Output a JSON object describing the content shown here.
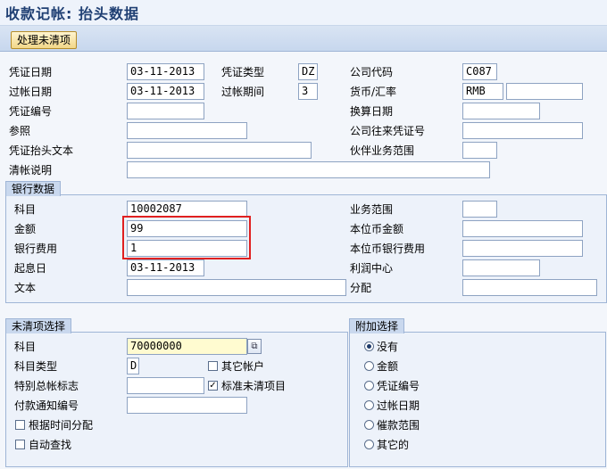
{
  "title": "收款记帐: 抬头数据",
  "toolbar": {
    "process_open_items": "处理未清项"
  },
  "header": {
    "doc_date_label": "凭证日期",
    "doc_date": "03-11-2013",
    "doc_type_label": "凭证类型",
    "doc_type": "DZ",
    "company_code_label": "公司代码",
    "company_code": "C087",
    "posting_date_label": "过帐日期",
    "posting_date": "03-11-2013",
    "period_label": "过帐期间",
    "period": "3",
    "currency_label": "货币/汇率",
    "currency": "RMB",
    "exchange_rate": "",
    "doc_number_label": "凭证编号",
    "doc_number": "",
    "translation_date_label": "换算日期",
    "translation_date": "",
    "reference_label": "参照",
    "reference": "",
    "intercompany_label": "公司往来凭证号",
    "intercompany": "",
    "header_text_label": "凭证抬头文本",
    "header_text": "",
    "partner_area_label": "伙伴业务范围",
    "partner_area": "",
    "clearing_text_label": "清帐说明",
    "clearing_text": ""
  },
  "bank": {
    "group_title": "银行数据",
    "account_label": "科目",
    "account": "10002087",
    "amount_label": "金额",
    "amount": "99",
    "bank_charges_label": "银行费用",
    "bank_charges": "1",
    "value_date_label": "起息日",
    "value_date": "03-11-2013",
    "text_label": "文本",
    "text": "",
    "business_area_label": "业务范围",
    "business_area": "",
    "lc_amount_label": "本位币金额",
    "lc_amount": "",
    "lc_bank_charges_label": "本位币银行费用",
    "lc_bank_charges": "",
    "profit_center_label": "利润中心",
    "profit_center": "",
    "assignment_label": "分配",
    "assignment": ""
  },
  "open_items": {
    "group_title": "未清项选择",
    "account_label": "科目",
    "account": "70000000",
    "account_type_label": "科目类型",
    "account_type": "D",
    "other_accounts_label": "其它帐户",
    "other_accounts_checked": false,
    "special_gl_label": "特别总帐标志",
    "special_gl": "",
    "standard_oi_label": "标准未清项目",
    "standard_oi_checked": true,
    "payment_advice_label": "付款通知编号",
    "payment_advice": "",
    "distribute_by_age_label": "根据时间分配",
    "distribute_by_age_checked": false,
    "auto_search_label": "自动查找",
    "auto_search_checked": false
  },
  "additional": {
    "group_title": "附加选择",
    "options": [
      "没有",
      "金额",
      "凭证编号",
      "过帐日期",
      "催款范围",
      "其它的"
    ],
    "selected_index": 0
  },
  "colors": {
    "highlight": "#e02020",
    "title": "#1f3f73",
    "button": "#f2d789"
  }
}
